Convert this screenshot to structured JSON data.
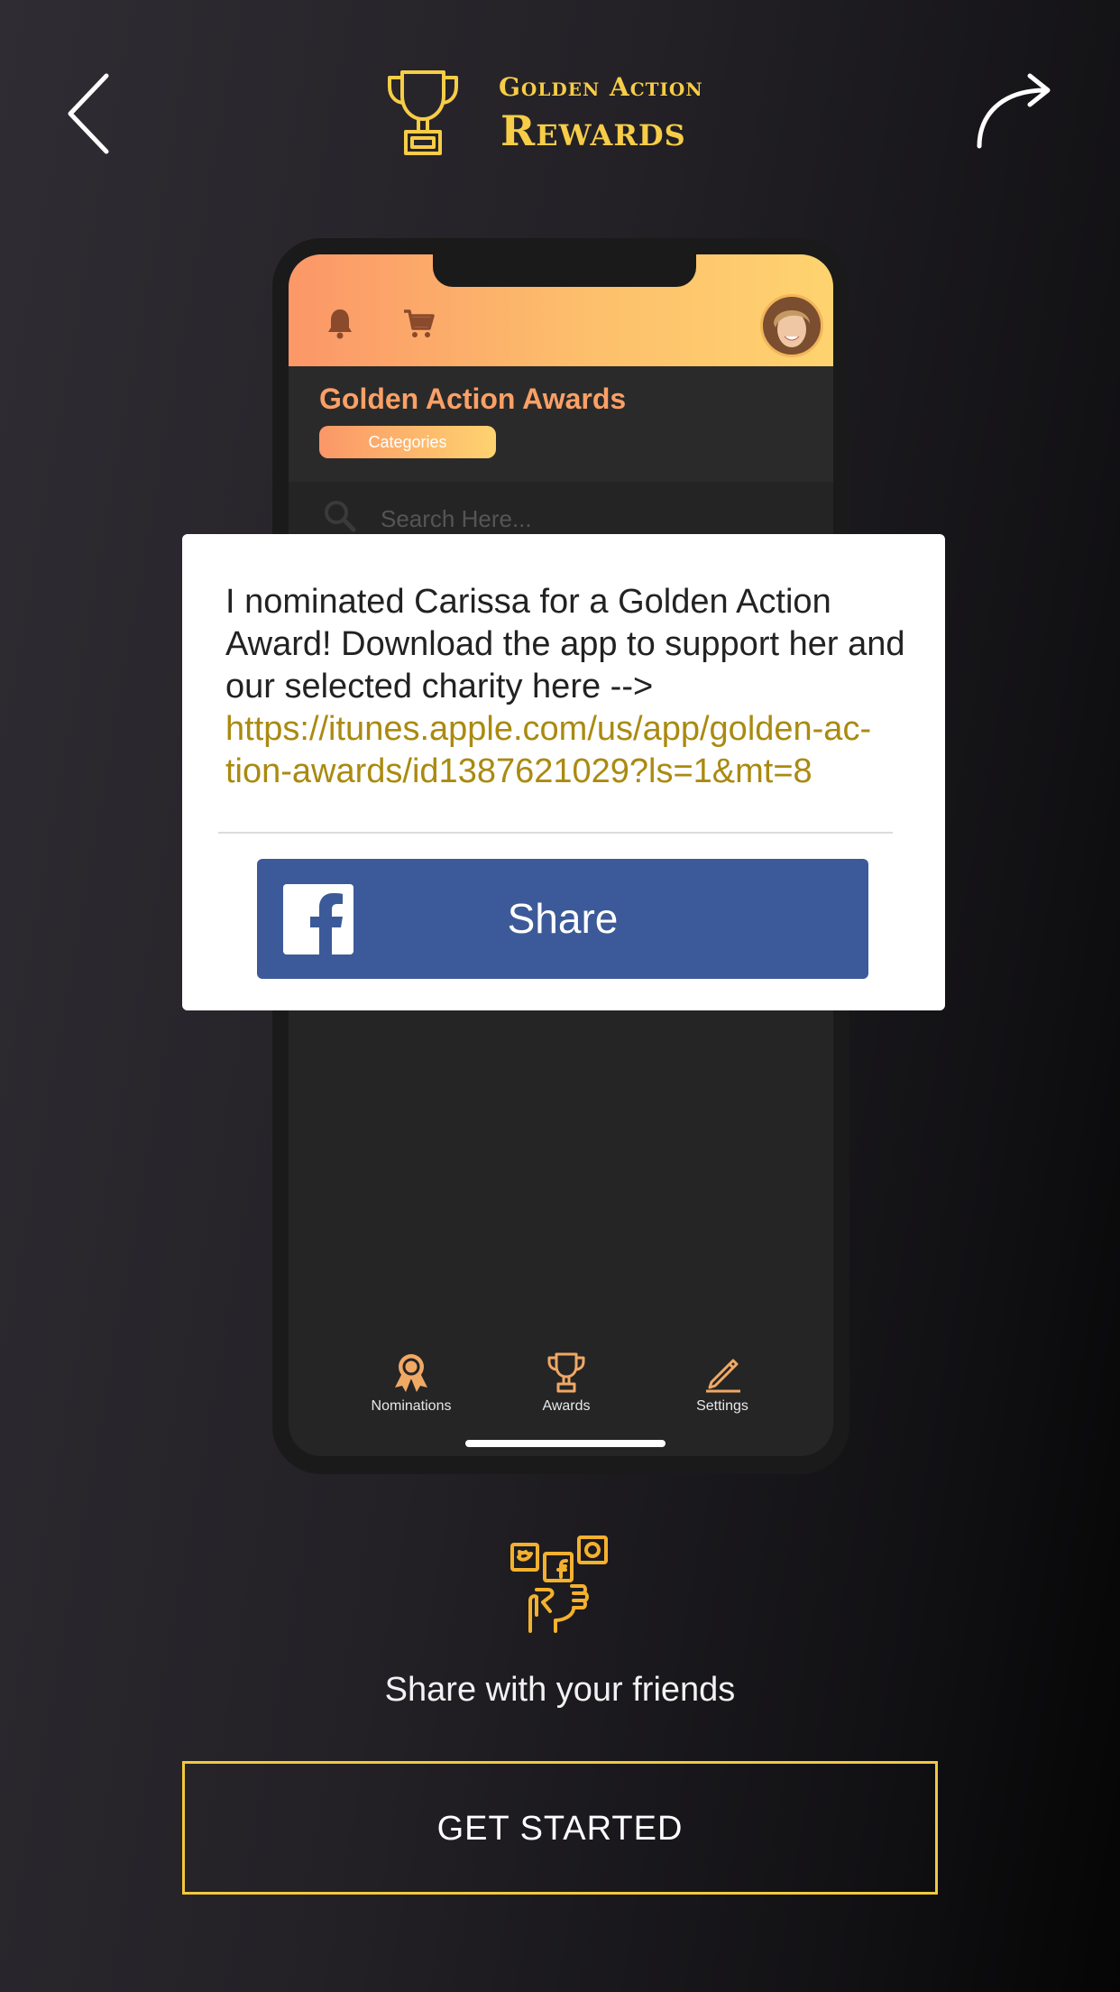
{
  "header": {
    "brand_line1": "Golden Action",
    "brand_line2": "Rewards",
    "back_icon": "chevron-left-icon",
    "share_icon": "share-arrow-icon",
    "trophy_icon": "trophy-icon"
  },
  "phone": {
    "app_title": "Golden Action Awards",
    "categories_label": "Categories",
    "search_placeholder": "Search Here...",
    "nav": [
      {
        "label": "Nominations",
        "icon": "ribbon-icon"
      },
      {
        "label": "Awards",
        "icon": "trophy-icon"
      },
      {
        "label": "Settings",
        "icon": "pencil-icon"
      }
    ]
  },
  "dialog": {
    "message": "I nominated Carissa for a Golden Action Award! Download the app to support her and our selected charity here -->",
    "link_line1": "https://itunes.apple.com/us/app/golden-ac-",
    "link_line2": "tion-awards/id1387621029?ls=1&mt=8",
    "share_label": "Share"
  },
  "footer": {
    "share_text": "Share with your friends",
    "get_started_label": "GET STARTED"
  },
  "colors": {
    "accent": "#f7cd47",
    "facebook": "#3c5a99",
    "link": "#aa8a10"
  }
}
